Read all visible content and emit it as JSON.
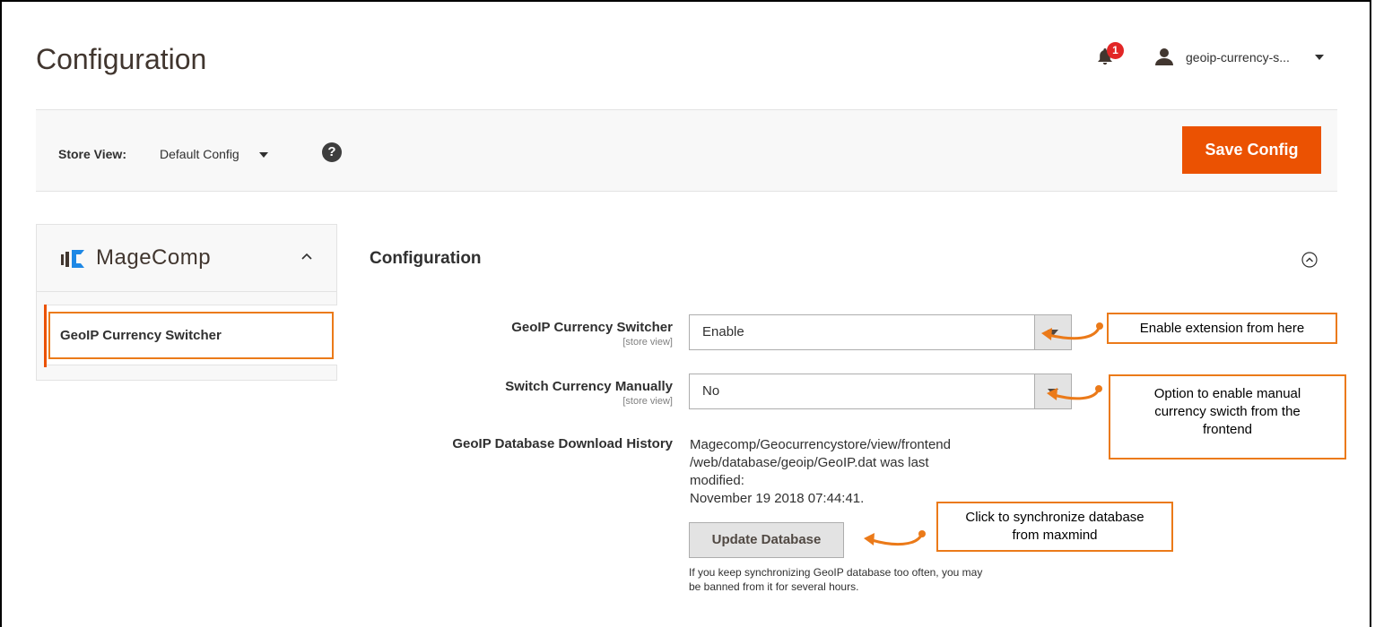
{
  "header": {
    "title": "Configuration",
    "notifications_count": "1",
    "user_name": "geoip-currency-s..."
  },
  "toolbar": {
    "scope_label": "Store View:",
    "scope_value": "Default Config",
    "help_glyph": "?",
    "save_label": "Save Config"
  },
  "sidebar": {
    "brand": "MageComp",
    "items": [
      {
        "label": "GeoIP Currency Switcher"
      }
    ]
  },
  "section": {
    "title": "Configuration",
    "fields": [
      {
        "label": "GeoIP Currency Switcher",
        "scope": "[store view]",
        "value": "Enable"
      },
      {
        "label": "Switch Currency Manually",
        "scope": "[store view]",
        "value": "No"
      }
    ],
    "history": {
      "label": "GeoIP Database Download History",
      "line1": "Magecomp/Geocurrencystore/view/frontend",
      "line2": "/web/database/geoip/GeoIP.dat was last modified:",
      "line3": "November 19 2018 07:44:41."
    },
    "update_button": "Update Database",
    "update_note_line1": "If you keep synchronizing GeoIP database too often, you may",
    "update_note_line2": "be banned from it for several hours."
  },
  "callouts": {
    "enable": "Enable extension from here",
    "manual_line1": "Option to enable manual",
    "manual_line2": "currency swicth from the",
    "manual_line3": "frontend",
    "sync_line1": "Click to synchronize database",
    "sync_line2": "from maxmind"
  },
  "colors": {
    "accent": "#eb5202",
    "annotation": "#eb7a19",
    "badge": "#e22626"
  },
  "icons": {
    "bell": "bell-icon",
    "user": "user-icon",
    "help": "help-icon",
    "collapse": "chevron-up-icon",
    "section_toggle": "circle-chevron-up-icon"
  }
}
